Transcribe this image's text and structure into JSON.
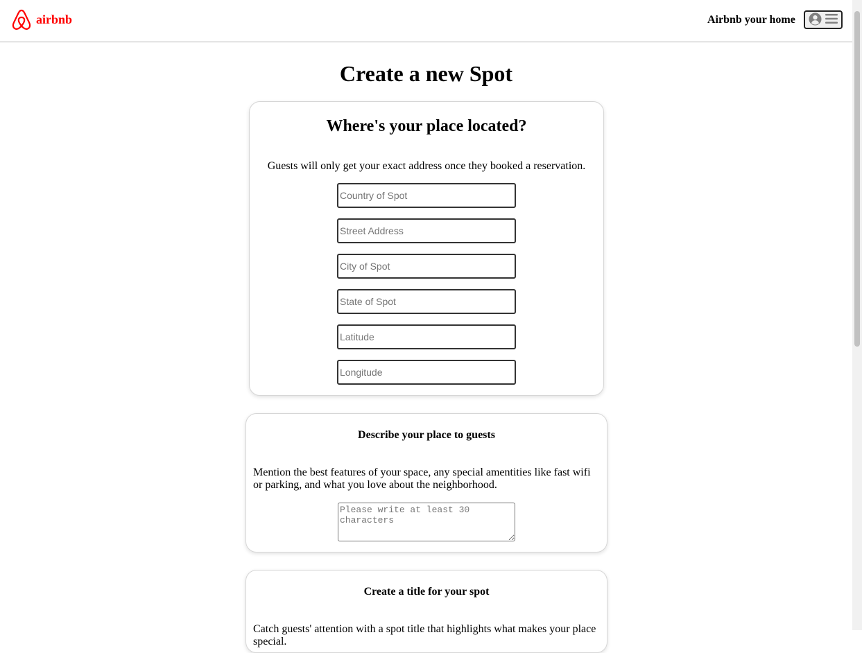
{
  "header": {
    "brand": "airbnb",
    "host_link": "Airbnb your home",
    "menu_icons": [
      "user-circle-icon",
      "hamburger-icon"
    ]
  },
  "colors": {
    "brand": "#ff0000",
    "border": "#333333"
  },
  "page": {
    "title": "Create a new Spot"
  },
  "location_section": {
    "heading": "Where's your place located?",
    "description": "Guests will only get your exact address once they booked a reservation.",
    "fields": [
      {
        "placeholder": "Country of Spot",
        "value": ""
      },
      {
        "placeholder": "Street Address",
        "value": ""
      },
      {
        "placeholder": "City of Spot",
        "value": ""
      },
      {
        "placeholder": "State of Spot",
        "value": ""
      },
      {
        "placeholder": "Latitude",
        "value": ""
      },
      {
        "placeholder": "Longitude",
        "value": ""
      }
    ]
  },
  "description_section": {
    "heading": "Describe your place to guests",
    "description": "Mention the best features of your space, any special amentities like fast wifi or parking, and what you love about the neighborhood.",
    "textarea_placeholder": "Please write at least 30 characters"
  },
  "title_section": {
    "heading": "Create a title for your spot",
    "description": "Catch guests' attention with a spot title that highlights what makes your place special."
  }
}
